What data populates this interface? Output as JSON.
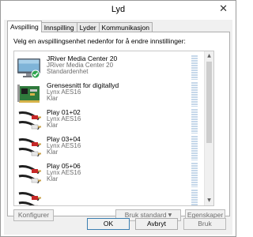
{
  "window": {
    "title": "Lyd",
    "close_glyph": "✕"
  },
  "tabs": [
    {
      "label": "Avspilling",
      "active": true
    },
    {
      "label": "Innspilling",
      "active": false
    },
    {
      "label": "Lyder",
      "active": false
    },
    {
      "label": "Kommunikasjon",
      "active": false
    }
  ],
  "instruction": "Velg en avspillingsenhet nedenfor for å endre innstillinger:",
  "devices": [
    {
      "name": "JRiver Media Center 20",
      "line2": "JRiver Media Center 20",
      "status": "Standardenhet",
      "icon": "monitor-icon",
      "default": true
    },
    {
      "name": "Grensesnitt for digitallyd",
      "line2": "Lynx AES16",
      "status": "Klar",
      "icon": "sound-card-icon",
      "default": false
    },
    {
      "name": "Play 01+02",
      "line2": "Lynx AES16",
      "status": "Klar",
      "icon": "rca-cable-icon",
      "default": false
    },
    {
      "name": "Play 03+04",
      "line2": "Lynx AES16",
      "status": "Klar",
      "icon": "rca-cable-icon",
      "default": false
    },
    {
      "name": "Play 05+06",
      "line2": "Lynx AES16",
      "status": "Klar",
      "icon": "rca-cable-icon",
      "default": false
    },
    {
      "name": "",
      "line2": "",
      "status": "",
      "icon": "rca-cable-icon",
      "default": false
    }
  ],
  "buttons": {
    "configure": "Konfigurer",
    "set_default": "Bruk standard",
    "properties": "Egenskaper",
    "ok": "OK",
    "cancel": "Avbryt",
    "apply": "Bruk"
  },
  "colors": {
    "check": "#2ea44f",
    "level_meter": "#c6d8ea",
    "default_border": "#3c7fb1"
  }
}
